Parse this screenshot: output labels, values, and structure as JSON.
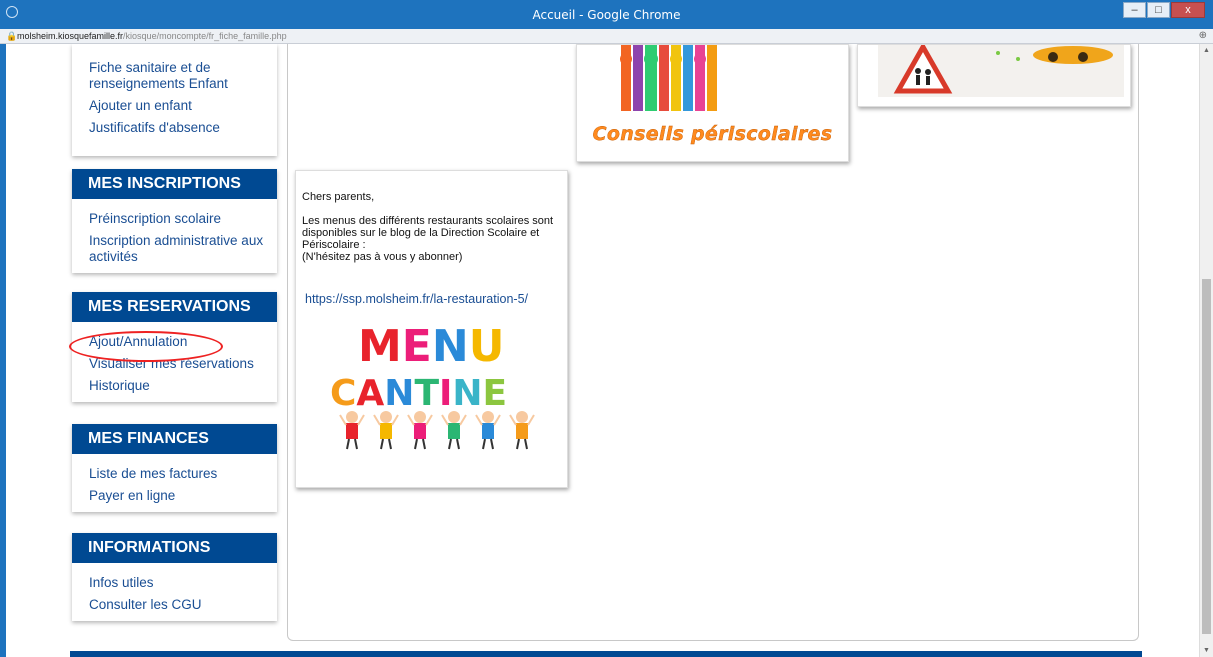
{
  "window": {
    "title": "Accueil - Google Chrome",
    "minimize_label": "–",
    "restore_label": "□",
    "close_label": "x"
  },
  "address": {
    "domain": "molsheim.kiosquefamille.fr",
    "path": "/kiosque/moncompte/fr_fiche_famille.php"
  },
  "menu": {
    "famille_items": [
      "Fiche sanitaire et de renseignements Enfant",
      "Ajouter un enfant",
      "Justificatifs d'absence"
    ],
    "inscriptions": {
      "header": "MES INSCRIPTIONS",
      "items": [
        "Préinscription scolaire",
        "Inscription administrative aux activités"
      ]
    },
    "reservations": {
      "header": "MES RESERVATIONS",
      "items": [
        "Ajout/Annulation",
        "Visualiser mes réservations",
        "Historique"
      ]
    },
    "finances": {
      "header": "MES FINANCES",
      "items": [
        "Liste de mes factures",
        "Payer en ligne"
      ]
    },
    "informations": {
      "header": "INFORMATIONS",
      "items": [
        "Infos utiles",
        "Consulter les CGU"
      ]
    }
  },
  "tiles": {
    "periscolaire_caption": "Conseils périscolaires",
    "cantine": {
      "greeting": "Chers parents,",
      "message": "Les menus des différents restaurants scolaires sont disponibles sur le blog de la Direction Scolaire et Périscolaire :",
      "note": "(N'hésitez pas à vous y abonner)",
      "link": "https://ssp.molsheim.fr/la-restauration-5/",
      "logo_line1": "MENU",
      "logo_line2": "CANTINE"
    }
  },
  "colors": {
    "menu_header": "#004992",
    "link": "#1a4e93",
    "chrome_blue": "#1e73be",
    "annotation": "#e22222"
  }
}
